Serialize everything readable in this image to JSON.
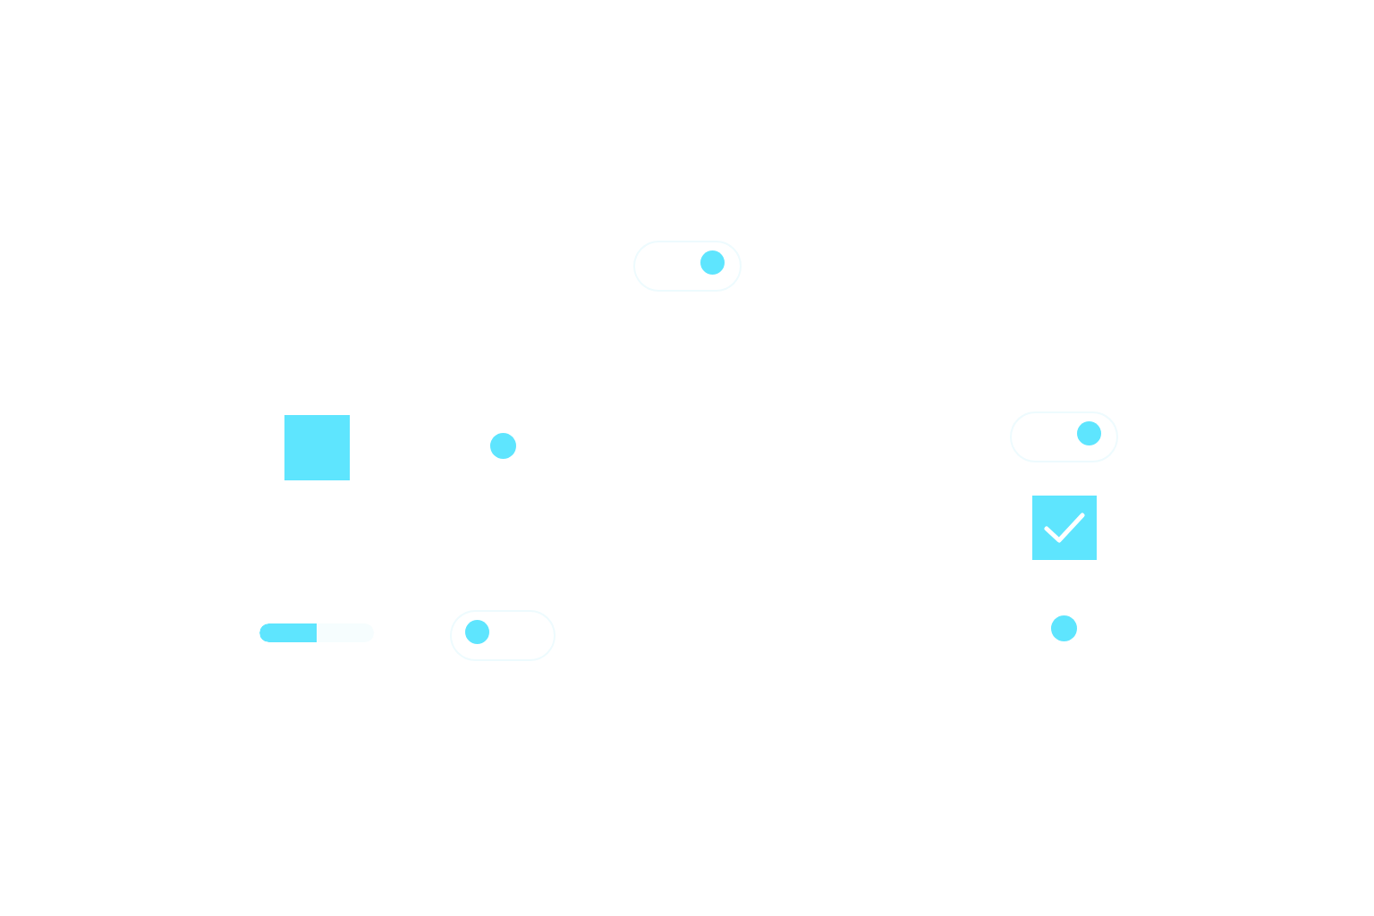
{
  "controls": [
    {
      "kind": "toggle",
      "on": true
    },
    {
      "kind": "swatch"
    },
    {
      "kind": "radio",
      "selected": true
    },
    {
      "kind": "toggle",
      "on": true
    },
    {
      "kind": "checkbox",
      "checked": true
    },
    {
      "kind": "progress",
      "level": 0.5
    },
    {
      "kind": "toggle",
      "on": false
    },
    {
      "kind": "radio",
      "selected": true
    }
  ]
}
